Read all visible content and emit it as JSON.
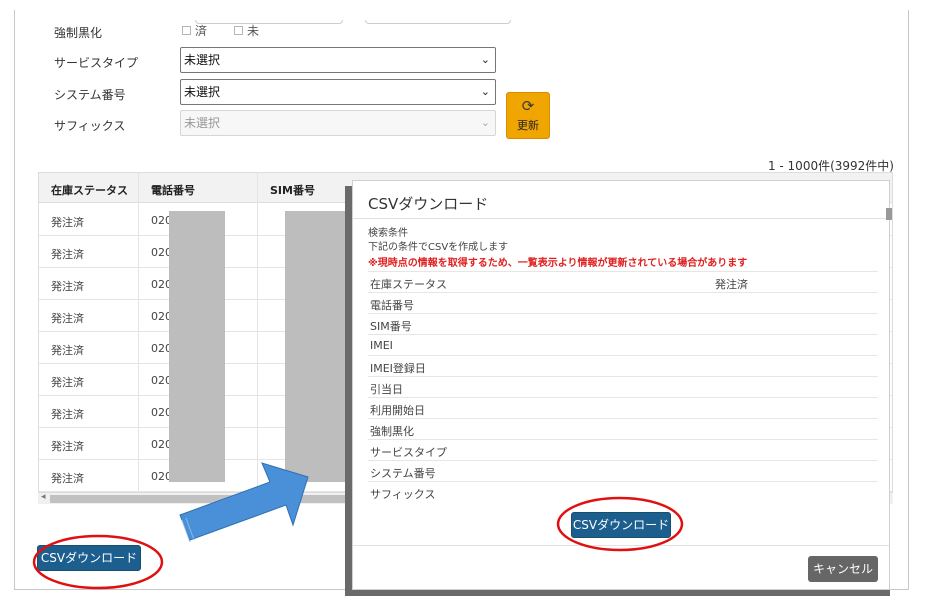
{
  "filters": {
    "forced_black": {
      "label": "強制黒化",
      "options": [
        "済",
        "未"
      ]
    },
    "service_type": {
      "label": "サービスタイプ",
      "value": "未選択"
    },
    "system_number": {
      "label": "システム番号",
      "value": "未選択"
    },
    "suffix": {
      "label": "サフィックス",
      "value": "未選択"
    },
    "refresh_label": "更新"
  },
  "result_count": "1 - 1000件(3992件中)",
  "table": {
    "headers": [
      "在庫ステータス",
      "電話番号",
      "SIM番号"
    ],
    "rows": [
      {
        "status": "発注済",
        "phone": "020"
      },
      {
        "status": "発注済",
        "phone": "020"
      },
      {
        "status": "発注済",
        "phone": "020"
      },
      {
        "status": "発注済",
        "phone": "020"
      },
      {
        "status": "発注済",
        "phone": "020"
      },
      {
        "status": "発注済",
        "phone": "020"
      },
      {
        "status": "発注済",
        "phone": "020"
      },
      {
        "status": "発注済",
        "phone": "020"
      },
      {
        "status": "発注済",
        "phone": "020"
      }
    ]
  },
  "csv_download_label": "CSVダウンロード",
  "modal": {
    "title": "CSVダウンロード",
    "search_conditions_label": "検索条件",
    "instruction": "下記の条件でCSVを作成します",
    "warning": "※現時点の情報を取得するため、一覧表示より情報が更新されている場合があります",
    "conditions": [
      {
        "key": "在庫ステータス",
        "value": "発注済"
      },
      {
        "key": "電話番号",
        "value": ""
      },
      {
        "key": "SIM番号",
        "value": ""
      },
      {
        "key": "IMEI",
        "value": ""
      },
      {
        "key": "IMEI登録日",
        "value": ""
      },
      {
        "key": "引当日",
        "value": ""
      },
      {
        "key": "利用開始日",
        "value": ""
      },
      {
        "key": "強制黒化",
        "value": ""
      },
      {
        "key": "サービスタイプ",
        "value": ""
      },
      {
        "key": "システム番号",
        "value": ""
      },
      {
        "key": "サフィックス",
        "value": ""
      }
    ],
    "download_label": "CSVダウンロード",
    "cancel_label": "キャンセル"
  },
  "annotations": {
    "highlight_color": "#e01010",
    "arrow_color": "#4a90d9"
  }
}
